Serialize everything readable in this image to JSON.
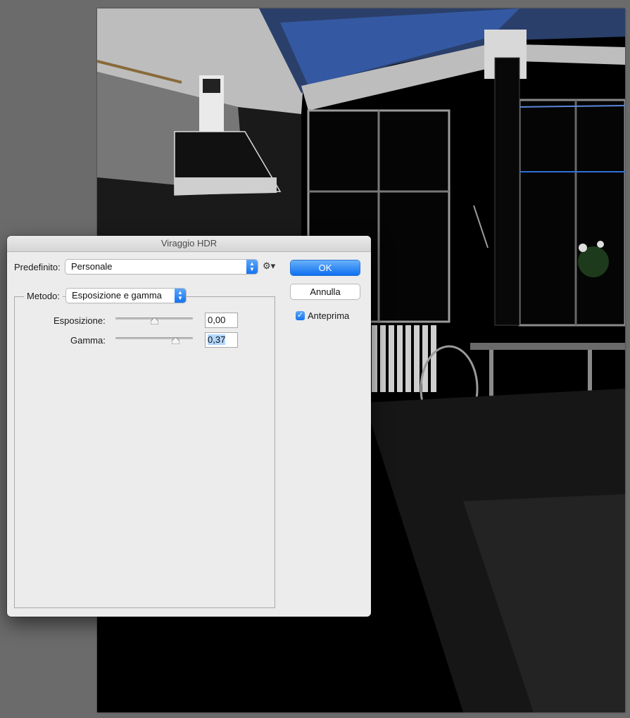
{
  "dialog": {
    "title": "Viraggio HDR",
    "preset_label": "Predefinito:",
    "preset_value": "Personale",
    "method_label": "Metodo:",
    "method_value": "Esposizione e gamma",
    "exposure_label": "Esposizione:",
    "exposure_value": "0,00",
    "gamma_label": "Gamma:",
    "gamma_value": "0,37",
    "ok_label": "OK",
    "cancel_label": "Annulla",
    "preview_label": "Anteprima",
    "preview_checked": true,
    "exposure_slider_level": 0.5,
    "gamma_slider_level": 0.78
  },
  "icons": {
    "gear": "gear-icon",
    "popup_arrows": "up-down-arrows-icon",
    "checkmark": "checkmark-icon"
  },
  "colors": {
    "accent": "#1673ee",
    "dialog_bg": "#ececec",
    "workspace_bg": "#6b6b6b",
    "canvas_bg": "#000000",
    "highlight_blue": "#2f6fd8"
  }
}
